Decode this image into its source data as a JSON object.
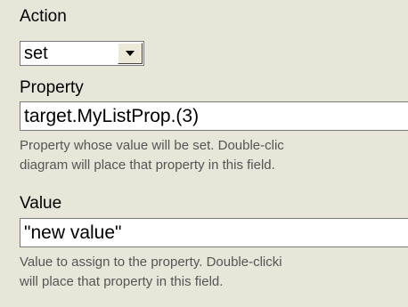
{
  "action": {
    "label": "Action",
    "selected": "set"
  },
  "property": {
    "label": "Property",
    "value": "target.MyListProp.(3)",
    "description_line1": "Property whose value will be set. Double-clic",
    "description_line2": "diagram will place that property in this field."
  },
  "value": {
    "label": "Value",
    "value": "\"new value\"",
    "description_line1": "Value to assign to the property. Double-clicki",
    "description_line2": "will place that property in this field."
  }
}
